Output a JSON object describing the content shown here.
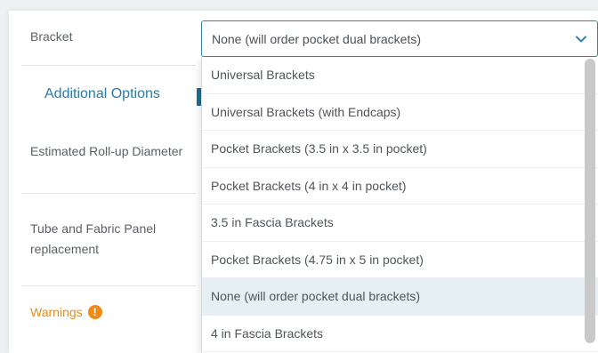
{
  "form": {
    "bracket_label": "Bracket",
    "section_tab": "Additional Options",
    "roll_up_label": "Estimated Roll-up Diameter",
    "tube_label": "Tube and Fabric Panel replacement",
    "warnings_label": "Warnings",
    "warning_icon_glyph": "!"
  },
  "select": {
    "value": "None (will order pocket dual brackets)",
    "expanded": true
  },
  "dropdown": {
    "options": [
      "Universal Brackets",
      "Universal Brackets (with Endcaps)",
      "Pocket Brackets (3.5 in x 3.5 in pocket)",
      "Pocket Brackets (4 in x 4 in pocket)",
      "3.5 in Fascia Brackets",
      "Pocket Brackets (4.75 in x 5 in pocket)",
      "None (will order pocket dual brackets)",
      "4 in Fascia Brackets"
    ],
    "selected_index": 6
  },
  "colors": {
    "accent": "#2f86b0",
    "tab_text": "#2a7aa5",
    "warning": "#f08a18",
    "selected_row": "#e6eff3"
  },
  "icons": {
    "dropdown": "chevron-down-icon",
    "warning": "exclamation-circle-icon"
  }
}
